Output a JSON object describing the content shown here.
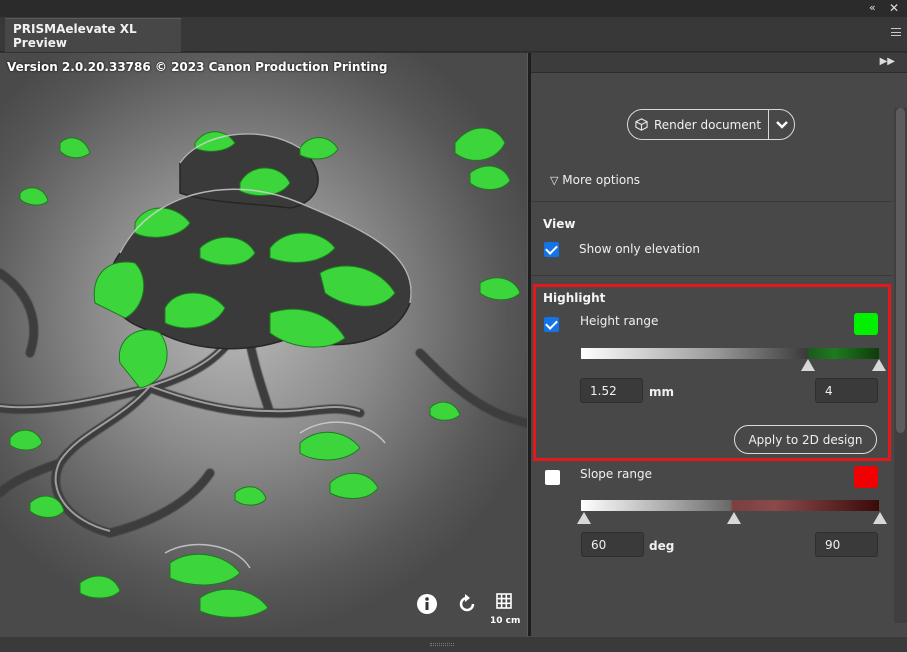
{
  "window": {
    "collapse_icon": "double-chevron-left-icon",
    "close_icon": "close-icon",
    "tab_title": "PRISMAelevate XL Preview",
    "menu_icon": "hamburger-menu-icon"
  },
  "preview": {
    "version_text": "Version 2.0.20.33786 © 2023 Canon Production Printing",
    "scale_label": "10 cm",
    "icons": [
      "info-icon",
      "reset-rotate-icon",
      "grid-icon"
    ]
  },
  "panel": {
    "expand_icon": "double-chevron-right-icon",
    "render_label": "Render document",
    "more_options_label": "More options",
    "view": {
      "title": "View",
      "show_only_elevation_label": "Show only elevation",
      "show_only_elevation_checked": true
    },
    "highlight": {
      "title": "Highlight",
      "height_range": {
        "label": "Height range",
        "checked": true,
        "color": "#00f000",
        "low_value": "1.52",
        "unit": "mm",
        "high_value": "4"
      },
      "apply_label": "Apply to 2D design"
    },
    "slope_range": {
      "label": "Slope range",
      "checked": false,
      "color": "#f00000",
      "low_value": "60",
      "unit": "deg",
      "high_value": "90"
    }
  },
  "colors": {
    "accent_blue": "#1473e6",
    "highlight_border": "#e31818",
    "elevation_green": "#3cd63c"
  }
}
